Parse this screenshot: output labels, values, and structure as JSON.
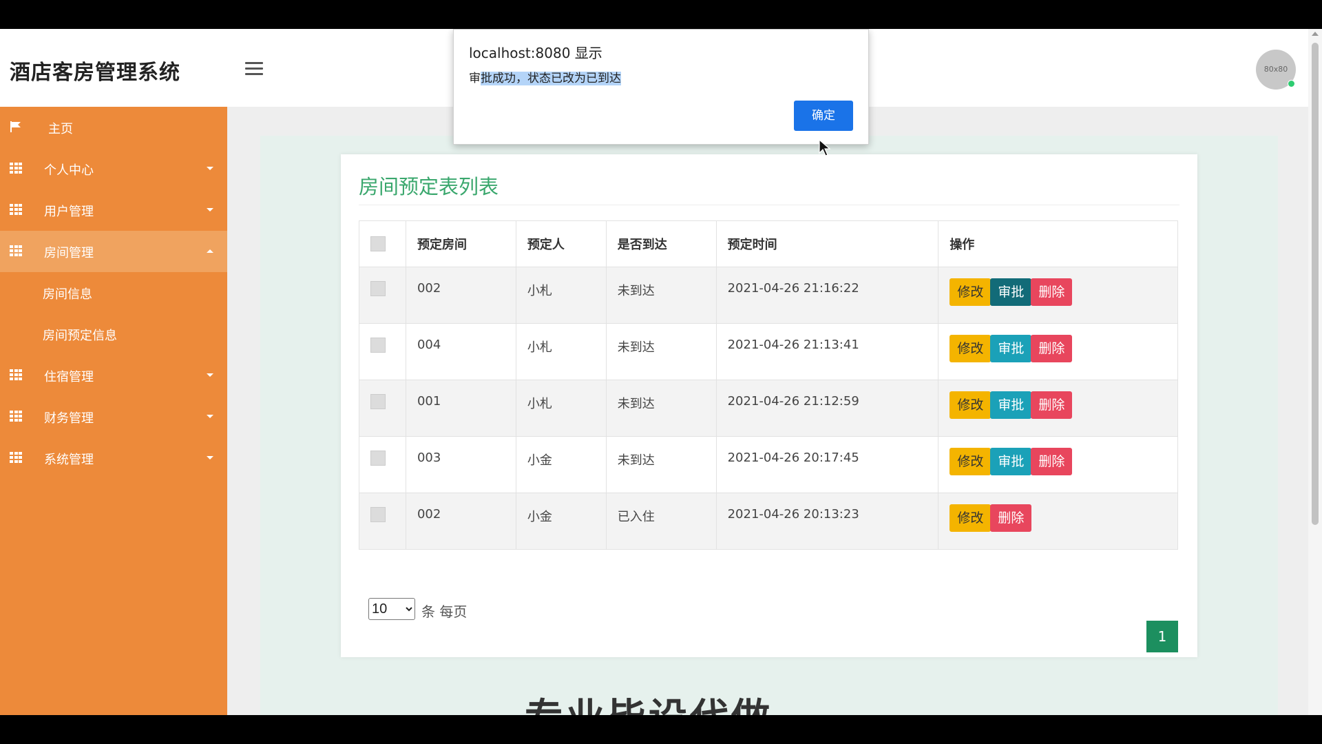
{
  "header": {
    "app_title": "酒店客房管理系统",
    "avatar_text": "80x80"
  },
  "sidebar": {
    "items": [
      {
        "label": "主页"
      },
      {
        "label": "个人中心"
      },
      {
        "label": "用户管理"
      },
      {
        "label": "房间管理"
      },
      {
        "label": "房间信息"
      },
      {
        "label": "房间预定信息"
      },
      {
        "label": "住宿管理"
      },
      {
        "label": "财务管理"
      },
      {
        "label": "系统管理"
      }
    ]
  },
  "card": {
    "title": "房间预定表列表",
    "columns": [
      "预定房间",
      "预定人",
      "是否到达",
      "预定时间",
      "操作"
    ],
    "rows": [
      {
        "room": "002",
        "person": "小札",
        "arrived": "未到达",
        "time": "2021-04-26 21:16:22"
      },
      {
        "room": "004",
        "person": "小札",
        "arrived": "未到达",
        "time": "2021-04-26 21:13:41"
      },
      {
        "room": "001",
        "person": "小札",
        "arrived": "未到达",
        "time": "2021-04-26 21:12:59"
      },
      {
        "room": "003",
        "person": "小金",
        "arrived": "未到达",
        "time": "2021-04-26 20:17:45"
      },
      {
        "room": "002",
        "person": "小金",
        "arrived": "已入住",
        "time": "2021-04-26 20:13:23"
      }
    ],
    "actions": {
      "edit": "修改",
      "approve": "审批",
      "delete": "删除"
    },
    "pager": {
      "page_size": "10",
      "per_page_label": "条 每页",
      "current_page": "1"
    }
  },
  "watermark": "专业毕设代做",
  "dialog": {
    "origin": "localhost:8080 显示",
    "message_prefix": "审",
    "message_selected": "批成功，状态已改为已到达",
    "ok_label": "确定"
  },
  "colors": {
    "sidebar": "#ed8a3a",
    "title_green": "#3aa76d",
    "edit": "#f4b400",
    "approve": "#1ba1b8",
    "delete": "#e8465d",
    "page_active": "#1c8f5f",
    "dialog_button": "#1a73e8"
  }
}
